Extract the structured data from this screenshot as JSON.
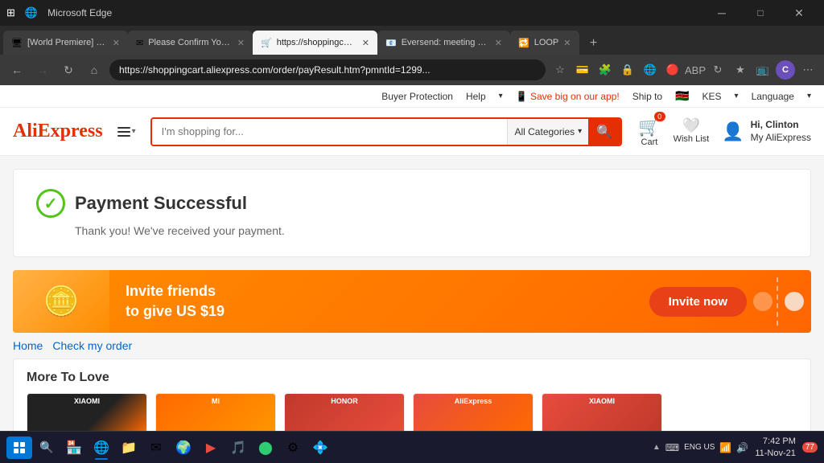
{
  "browser": {
    "tabs": [
      {
        "id": "tab1",
        "favicon": "🖥",
        "title": "[World Premiere] Xiaomi...",
        "active": false
      },
      {
        "id": "tab2",
        "favicon": "✉",
        "title": "Please Confirm Your Or...",
        "active": false
      },
      {
        "id": "tab3",
        "favicon": "🛒",
        "title": "https://shoppingcart.alie...",
        "active": true
      },
      {
        "id": "tab4",
        "favicon": "📧",
        "title": "Eversend: meeting all yo",
        "active": false
      },
      {
        "id": "tab5",
        "favicon": "🔁",
        "title": "LOOP",
        "active": false
      }
    ],
    "url": "https://shoppingcart.aliexpress.com/order/payResult.htm?pmntId=1299...",
    "nav_back_disabled": false,
    "nav_forward_disabled": true
  },
  "utility_bar": {
    "buyer_protection": "Buyer Protection",
    "help": "Help",
    "app_promo": "Save big on our app!",
    "ship_to": "Ship to",
    "currency": "KES",
    "language": "Language"
  },
  "header": {
    "logo": "AliExpress",
    "search_placeholder": "I'm shopping for...",
    "categories_label": "All Categories",
    "cart_label": "Cart",
    "cart_count": "0",
    "wishlist_label": "Wish List",
    "user_greeting": "Hi, Clinton",
    "user_account": "My AliExpress"
  },
  "payment": {
    "title": "Payment Successful",
    "subtitle": "Thank you! We've received your payment.",
    "success_check": "✓"
  },
  "banner": {
    "main_text": "Invite friends",
    "sub_text": "to give US $19",
    "button_label": "Invite now"
  },
  "nav_links": [
    {
      "label": "Home",
      "href": "#"
    },
    {
      "label": "Check my order",
      "href": "#"
    }
  ],
  "more_section": {
    "title": "More To Love",
    "products": [
      {
        "id": "p1",
        "label": "XIAOMI",
        "style": "card-xiaomi-1"
      },
      {
        "id": "p2",
        "label": "MI",
        "style": "card-mi"
      },
      {
        "id": "p3",
        "label": "HONOR",
        "style": "card-honor"
      },
      {
        "id": "p4",
        "label": "AliExpress",
        "style": "card-ali"
      },
      {
        "id": "p5",
        "label": "XIAOMI",
        "style": "card-xiaomi-2"
      }
    ]
  },
  "taskbar": {
    "time": "7:42 PM",
    "date": "11-Nov-21",
    "language": "ENG US",
    "notification_count": "77",
    "apps": [
      {
        "id": "start",
        "icon": "⊞",
        "label": "Start"
      },
      {
        "id": "search",
        "icon": "🔍",
        "label": "Search"
      },
      {
        "id": "store",
        "icon": "🏪",
        "label": "Store"
      },
      {
        "id": "edge",
        "icon": "🌐",
        "label": "Edge"
      },
      {
        "id": "explorer",
        "icon": "📁",
        "label": "File Explorer"
      },
      {
        "id": "mail",
        "icon": "✉",
        "label": "Mail"
      },
      {
        "id": "chrome",
        "icon": "🌍",
        "label": "Chrome"
      },
      {
        "id": "media",
        "icon": "▶",
        "label": "Media"
      },
      {
        "id": "app7",
        "icon": "🎵",
        "label": "Music"
      },
      {
        "id": "app8",
        "icon": "🟢",
        "label": "App"
      },
      {
        "id": "settings",
        "icon": "⚙",
        "label": "Settings"
      },
      {
        "id": "app9",
        "icon": "💠",
        "label": "App"
      }
    ]
  }
}
